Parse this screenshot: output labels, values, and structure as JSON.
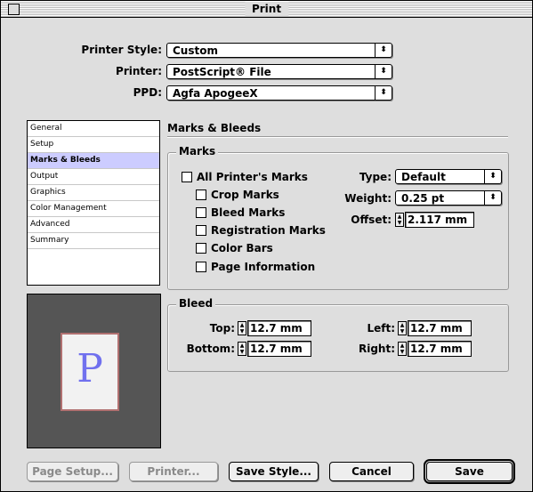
{
  "window": {
    "title": "Print"
  },
  "top": {
    "printer_style": {
      "label": "Printer Style:",
      "value": "Custom"
    },
    "printer": {
      "label": "Printer:",
      "value": "PostScript® File"
    },
    "ppd": {
      "label": "PPD:",
      "value": "Agfa ApogeeX"
    }
  },
  "sidebar": {
    "items": [
      {
        "label": "General"
      },
      {
        "label": "Setup"
      },
      {
        "label": "Marks & Bleeds"
      },
      {
        "label": "Output"
      },
      {
        "label": "Graphics"
      },
      {
        "label": "Color Management"
      },
      {
        "label": "Advanced"
      },
      {
        "label": "Summary"
      }
    ],
    "selected": "Marks & Bleeds"
  },
  "preview": {
    "glyph": "P"
  },
  "panel": {
    "title": "Marks & Bleeds",
    "marks": {
      "title": "Marks",
      "all_printers_marks": "All Printer's Marks",
      "crop_marks": "Crop Marks",
      "bleed_marks": "Bleed Marks",
      "registration_marks": "Registration Marks",
      "color_bars": "Color Bars",
      "page_information": "Page Information",
      "type_label": "Type:",
      "type_value": "Default",
      "weight_label": "Weight:",
      "weight_value": "0.25 pt",
      "offset_label": "Offset:",
      "offset_value": "2.117 mm"
    },
    "bleed": {
      "title": "Bleed",
      "top_label": "Top:",
      "top_value": "12.7 mm",
      "bottom_label": "Bottom:",
      "bottom_value": "12.7 mm",
      "left_label": "Left:",
      "left_value": "12.7 mm",
      "right_label": "Right:",
      "right_value": "12.7 mm"
    }
  },
  "buttons": {
    "page_setup": "Page Setup...",
    "printer": "Printer...",
    "save_style": "Save Style...",
    "cancel": "Cancel",
    "save": "Save"
  }
}
